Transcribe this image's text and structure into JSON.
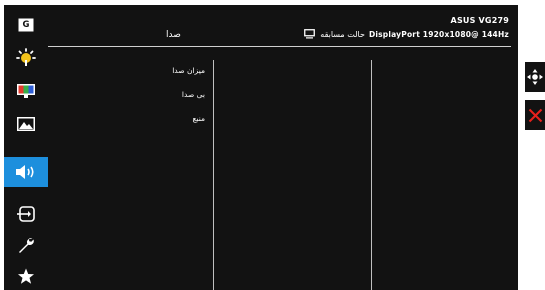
{
  "header": {
    "model": "ASUS VG279",
    "timing": "DisplayPort 1920x1080@ 144Hz",
    "mode": "حالت مسابقه"
  },
  "menu": {
    "title": "صدا",
    "items": [
      {
        "label": "میزان صدا"
      },
      {
        "label": "بی صدا"
      },
      {
        "label": "منبع"
      }
    ]
  },
  "sidebar": {
    "items": [
      {
        "icon": "gameplus-icon",
        "active": false
      },
      {
        "icon": "brightness-icon",
        "active": false
      },
      {
        "icon": "color-icon",
        "active": false
      },
      {
        "icon": "image-icon",
        "active": false
      },
      {
        "icon": "sound-icon",
        "active": true
      },
      {
        "icon": "input-select-icon",
        "active": false
      },
      {
        "icon": "system-setup-icon",
        "active": false
      },
      {
        "icon": "favorite-icon",
        "active": false
      }
    ]
  },
  "controls": {
    "navigate": "five-way-navigate-icon",
    "close": "close-icon"
  },
  "colors": {
    "panel_bg": "#121212",
    "accent": "#1d8fdd",
    "text": "#ffffff",
    "divider": "#bfbfbf",
    "close_red": "#e8201c"
  }
}
